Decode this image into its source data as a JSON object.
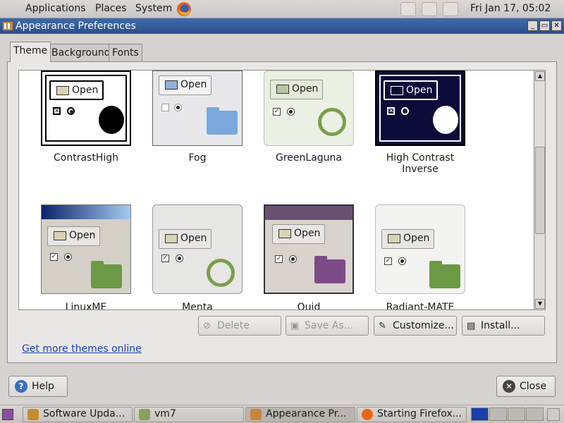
{
  "top_panel": {
    "menus": [
      "Applications",
      "Places",
      "System"
    ],
    "clock": "Fri Jan 17, 05:02"
  },
  "window": {
    "title": "Appearance Preferences",
    "buttons": [
      "_",
      "▭",
      "✕"
    ]
  },
  "tabs": [
    "Theme",
    "Background",
    "Fonts"
  ],
  "themes": [
    {
      "name": "ContrastHigh",
      "open_label": "Open"
    },
    {
      "name": "Fog",
      "open_label": "Open"
    },
    {
      "name": "GreenLaguna",
      "open_label": "Open"
    },
    {
      "name": "High Contrast Inverse",
      "open_label": "Open"
    },
    {
      "name": "LinuxME",
      "open_label": "Open"
    },
    {
      "name": "Menta",
      "open_label": "Open"
    },
    {
      "name": "Quid",
      "open_label": "Open"
    },
    {
      "name": "Radiant-MATE",
      "open_label": "Open"
    }
  ],
  "actions": {
    "delete": "Delete",
    "save_as": "Save As...",
    "customize": "Customize...",
    "install": "Install..."
  },
  "link_get_more": "Get more themes online",
  "footer": {
    "help": "Help",
    "close": "Close"
  },
  "taskbar": {
    "tasks": [
      "Software Upda...",
      "vm7",
      "Appearance Pr...",
      "Starting Firefox..."
    ]
  },
  "colors": {
    "titlebar": "#2f5897",
    "link": "#1a3fb8"
  }
}
